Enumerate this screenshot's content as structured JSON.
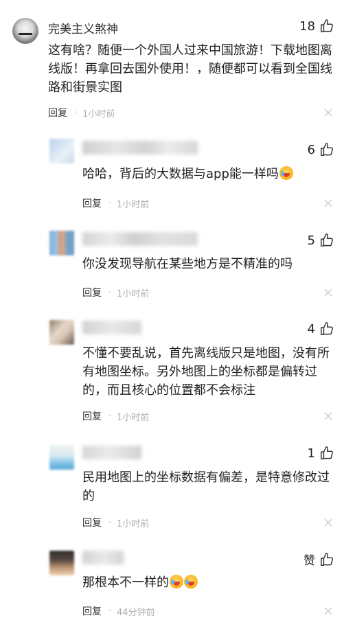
{
  "comments": [
    {
      "name": "完美主义煞神",
      "likes": "18",
      "text": "这有啥？随便一个外国人过来中国旅游！下载地图离线版！再拿回去国外使用！，随便都可以看到全国线路和街景实图",
      "reply": "回复",
      "time": "1小时前"
    },
    {
      "likes": "6",
      "text": "哈哈，背后的大数据与app能一样吗",
      "reply": "回复",
      "time": "1小时前"
    },
    {
      "likes": "5",
      "text": "你没发现导航在某些地方是不精准的吗",
      "reply": "回复",
      "time": "1小时前"
    },
    {
      "likes": "4",
      "text": "不懂不要乱说，首先离线版只是地图，没有所有地图坐标。另外地图上的坐标都是偏转过的，而且核心的位置都不会标注",
      "reply": "回复",
      "time": "1小时前"
    },
    {
      "likes": "1",
      "text": "民用地图上的坐标数据有偏差，是特意修改过的",
      "reply": "回复",
      "time": "1小时前"
    },
    {
      "likes": "赞",
      "text": "那根本不一样的",
      "reply": "回复",
      "time": "44分钟前"
    }
  ],
  "icons": {
    "thumb": "thumbs-up-icon",
    "close": "close-icon",
    "emoji": "laughing-tears-emoji"
  }
}
